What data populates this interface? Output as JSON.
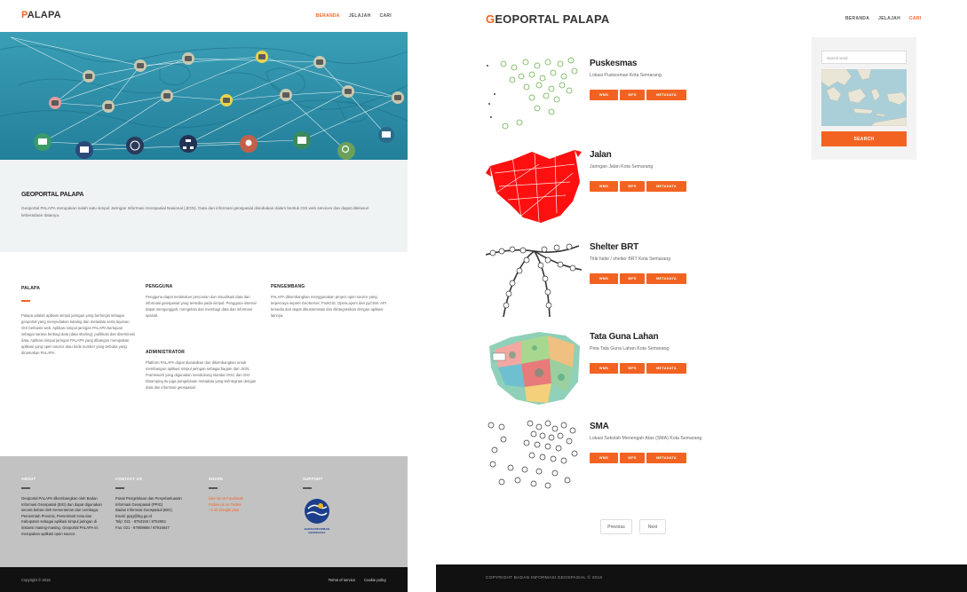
{
  "left": {
    "logo_first": "P",
    "logo_rest": "ALAPA",
    "nav": [
      "BERANDA",
      "JELAJAH",
      "CARI"
    ],
    "intro": {
      "title": "GEOPORTAL PALAPA",
      "text": "Geoportal PALAPA merupakan salah satu simpul Jaringan Informasi Geospasial Nasional (JIGN). Data dan informasi geospasial disediakan dalam bentuk GIS web services dan dapat ditelusuri keberadaan datanya."
    },
    "palapa": {
      "title": "PALAPA",
      "text": "Palapa adalah aplikasi simpul jaringan yang berfungsi sebagai geoportal yang menyediakan katalog dan metadata serta layanan GIS berbasis web. Aplikasi simpul jaringan PALAPA bertujuan sebagai sarana berbagi data (data sharing), publikasi dan diseminasi data. Aplikasi simpul jaringan PALAPA yang dibangun merupakan aplikasi yang open source atau kode sumber yang terbuka yang dinamakan PALAPA."
    },
    "pengguna": {
      "title": "PENGGUNA",
      "text": "Pengguna dapat melakukan pencarian dan visualisasi data dan informasi geospasial yang tersedia pada simpul. Pengguna internal dapat mengunggah, mengelola dan membagi data dan informasi spasial."
    },
    "pengembang": {
      "title": "PENGEMBANG",
      "text": "PALAPA dikembangkan menggunakan project open source yang terpercaya seperti GeoServer, PostGIS, OpenLayers dan pyCSW. API tersedia dan dapat dikustomisasi dan diintegrasikan dengan aplikasi lainnya."
    },
    "administrator": {
      "title": "ADMINISTRATOR",
      "text": "Platform PALAPA dapat diandalkan dan dikembangkan untuk membangun aplikasi simpul jaringan sebagai bagian dari JIGN. Framework yang digunakan mendukung standar OGC dan ISO. Disamping itu juga pengelolaan metadata yang terintegrasi dengan data dan informasi geospasial."
    },
    "footer": {
      "about_title": "ABOUT",
      "about_text": "Geoportal PALAPA dikembangkan oleh Badan Informasi Geospasial (BIG) dan dapat digunakan secara bebas oleh Kementerian dan Lembaga, Pemerintah Provinsi, Pemerintah Kota dan Kabupaten sebagai aplikasi simpul jaringan di instansi masing-masing. Geoportal PALAPA ini merupakan aplikasi open source.",
      "contact_title": "CONTACT US",
      "contact_lines": [
        "Pusat Pengelolaan dan Penyebarluasan",
        "Informasi Geospasial (PPIG)",
        "Badan Informasi Geospasial (BIG)",
        "Email: ppig@big.go.id",
        "Telp: 021 - 8753155 / 8752062",
        "Fax: 021 - 87908988 / 87916647"
      ],
      "share_title": "SHARE",
      "share_lines": [
        "Like us on Facebook",
        "Follow us on Twitter",
        "+1 on Google plus"
      ],
      "support_title": "SUPPORT",
      "support_logo_text": "BADAN INFORMASI GEOSPASIAL",
      "copyright": "Copyright © 2016",
      "bottom_links": [
        "Terms of service",
        "Cookie policy"
      ]
    }
  },
  "right": {
    "logo_first": "G",
    "logo_rest": "EOPORTAL PALAPA",
    "nav": [
      "BERANDA",
      "JELAJAH",
      "CARI"
    ],
    "items": [
      {
        "title": "Puskesmas",
        "desc": "Lokasi Puskesmas Kota Semarang"
      },
      {
        "title": "Jalan",
        "desc": "Jaringan Jalan Kota Semarang"
      },
      {
        "title": "Shelter BRT",
        "desc": "Titik halte / shelter BRT Kota Semarang"
      },
      {
        "title": "Tata Guna Lahan",
        "desc": "Peta Tata Guna Lahan Kota Semarang"
      },
      {
        "title": "SMA",
        "desc": "Lokasi Sekolah Menengah Atas (SMA) Kota Semarang"
      }
    ],
    "buttons": [
      "WMS",
      "WFS",
      "METADATA"
    ],
    "search": {
      "placeholder": "Search word",
      "button": "SEARCH"
    },
    "pager": {
      "previous": "Previous",
      "next": "Next"
    },
    "copyright": "COPYRIGHT BADAN INFORMASI GEOSPASIAL © 2016"
  },
  "colors": {
    "accent": "#f26322",
    "dark": "#111111",
    "footer_grey": "#c2c2c2"
  }
}
